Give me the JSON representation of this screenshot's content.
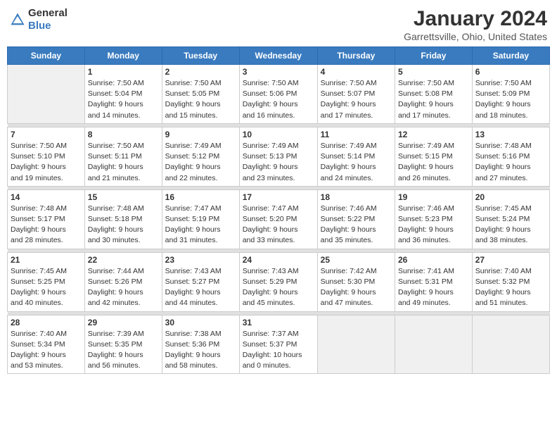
{
  "header": {
    "logo_general": "General",
    "logo_blue": "Blue",
    "month": "January 2024",
    "location": "Garrettsville, Ohio, United States"
  },
  "weekdays": [
    "Sunday",
    "Monday",
    "Tuesday",
    "Wednesday",
    "Thursday",
    "Friday",
    "Saturday"
  ],
  "weeks": [
    [
      {
        "empty": true
      },
      {
        "day": 1,
        "sunrise": "7:50 AM",
        "sunset": "5:04 PM",
        "daylight": "9 hours and 14 minutes."
      },
      {
        "day": 2,
        "sunrise": "7:50 AM",
        "sunset": "5:05 PM",
        "daylight": "9 hours and 15 minutes."
      },
      {
        "day": 3,
        "sunrise": "7:50 AM",
        "sunset": "5:06 PM",
        "daylight": "9 hours and 16 minutes."
      },
      {
        "day": 4,
        "sunrise": "7:50 AM",
        "sunset": "5:07 PM",
        "daylight": "9 hours and 17 minutes."
      },
      {
        "day": 5,
        "sunrise": "7:50 AM",
        "sunset": "5:08 PM",
        "daylight": "9 hours and 17 minutes."
      },
      {
        "day": 6,
        "sunrise": "7:50 AM",
        "sunset": "5:09 PM",
        "daylight": "9 hours and 18 minutes."
      }
    ],
    [
      {
        "day": 7,
        "sunrise": "7:50 AM",
        "sunset": "5:10 PM",
        "daylight": "9 hours and 19 minutes."
      },
      {
        "day": 8,
        "sunrise": "7:50 AM",
        "sunset": "5:11 PM",
        "daylight": "9 hours and 21 minutes."
      },
      {
        "day": 9,
        "sunrise": "7:49 AM",
        "sunset": "5:12 PM",
        "daylight": "9 hours and 22 minutes."
      },
      {
        "day": 10,
        "sunrise": "7:49 AM",
        "sunset": "5:13 PM",
        "daylight": "9 hours and 23 minutes."
      },
      {
        "day": 11,
        "sunrise": "7:49 AM",
        "sunset": "5:14 PM",
        "daylight": "9 hours and 24 minutes."
      },
      {
        "day": 12,
        "sunrise": "7:49 AM",
        "sunset": "5:15 PM",
        "daylight": "9 hours and 26 minutes."
      },
      {
        "day": 13,
        "sunrise": "7:48 AM",
        "sunset": "5:16 PM",
        "daylight": "9 hours and 27 minutes."
      }
    ],
    [
      {
        "day": 14,
        "sunrise": "7:48 AM",
        "sunset": "5:17 PM",
        "daylight": "9 hours and 28 minutes."
      },
      {
        "day": 15,
        "sunrise": "7:48 AM",
        "sunset": "5:18 PM",
        "daylight": "9 hours and 30 minutes."
      },
      {
        "day": 16,
        "sunrise": "7:47 AM",
        "sunset": "5:19 PM",
        "daylight": "9 hours and 31 minutes."
      },
      {
        "day": 17,
        "sunrise": "7:47 AM",
        "sunset": "5:20 PM",
        "daylight": "9 hours and 33 minutes."
      },
      {
        "day": 18,
        "sunrise": "7:46 AM",
        "sunset": "5:22 PM",
        "daylight": "9 hours and 35 minutes."
      },
      {
        "day": 19,
        "sunrise": "7:46 AM",
        "sunset": "5:23 PM",
        "daylight": "9 hours and 36 minutes."
      },
      {
        "day": 20,
        "sunrise": "7:45 AM",
        "sunset": "5:24 PM",
        "daylight": "9 hours and 38 minutes."
      }
    ],
    [
      {
        "day": 21,
        "sunrise": "7:45 AM",
        "sunset": "5:25 PM",
        "daylight": "9 hours and 40 minutes."
      },
      {
        "day": 22,
        "sunrise": "7:44 AM",
        "sunset": "5:26 PM",
        "daylight": "9 hours and 42 minutes."
      },
      {
        "day": 23,
        "sunrise": "7:43 AM",
        "sunset": "5:27 PM",
        "daylight": "9 hours and 44 minutes."
      },
      {
        "day": 24,
        "sunrise": "7:43 AM",
        "sunset": "5:29 PM",
        "daylight": "9 hours and 45 minutes."
      },
      {
        "day": 25,
        "sunrise": "7:42 AM",
        "sunset": "5:30 PM",
        "daylight": "9 hours and 47 minutes."
      },
      {
        "day": 26,
        "sunrise": "7:41 AM",
        "sunset": "5:31 PM",
        "daylight": "9 hours and 49 minutes."
      },
      {
        "day": 27,
        "sunrise": "7:40 AM",
        "sunset": "5:32 PM",
        "daylight": "9 hours and 51 minutes."
      }
    ],
    [
      {
        "day": 28,
        "sunrise": "7:40 AM",
        "sunset": "5:34 PM",
        "daylight": "9 hours and 53 minutes."
      },
      {
        "day": 29,
        "sunrise": "7:39 AM",
        "sunset": "5:35 PM",
        "daylight": "9 hours and 56 minutes."
      },
      {
        "day": 30,
        "sunrise": "7:38 AM",
        "sunset": "5:36 PM",
        "daylight": "9 hours and 58 minutes."
      },
      {
        "day": 31,
        "sunrise": "7:37 AM",
        "sunset": "5:37 PM",
        "daylight": "10 hours and 0 minutes."
      },
      {
        "empty": true
      },
      {
        "empty": true
      },
      {
        "empty": true
      }
    ]
  ]
}
